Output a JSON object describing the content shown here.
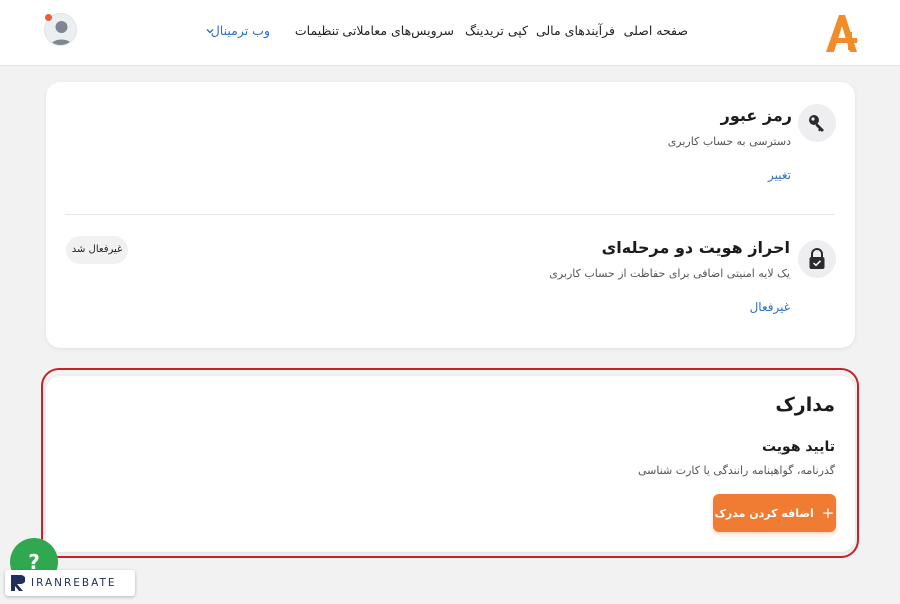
{
  "nav": {
    "home": "صفحه اصلی",
    "financial": "فرآیندهای مالی",
    "copy_trading": "کپی تریدینگ",
    "trading_services": "سرویس‌های معاملاتی",
    "settings": "تنظیمات",
    "web_terminal": "وب ترمینال"
  },
  "security": {
    "password": {
      "title": "رمز عبور",
      "subtitle": "دسترسی به حساب کاربری",
      "action": "تغییر"
    },
    "two_factor": {
      "title": "احراز هویت دو مرحله‌ای",
      "subtitle": "یک لایه امنیتی اضافی برای حفاظت از حساب کاربری",
      "action": "غیرفعال",
      "status_badge": "غیرفعال شد"
    }
  },
  "documents": {
    "title": "مدارک",
    "identity": {
      "title": "تایید هویت",
      "subtitle": "گذرنامه، گواهینامه رانندگی یا کارت شناسی"
    },
    "add_button": "اضافه کردن مدرک",
    "add_button_icon": "+"
  },
  "watermark": {
    "help_icon": "?",
    "brand_text": "IRANREBATE"
  },
  "colors": {
    "accent_orange": "#f07c34",
    "link_blue": "#2f6fbe",
    "highlight_red": "#c8212b",
    "help_green": "#2fa84f"
  }
}
